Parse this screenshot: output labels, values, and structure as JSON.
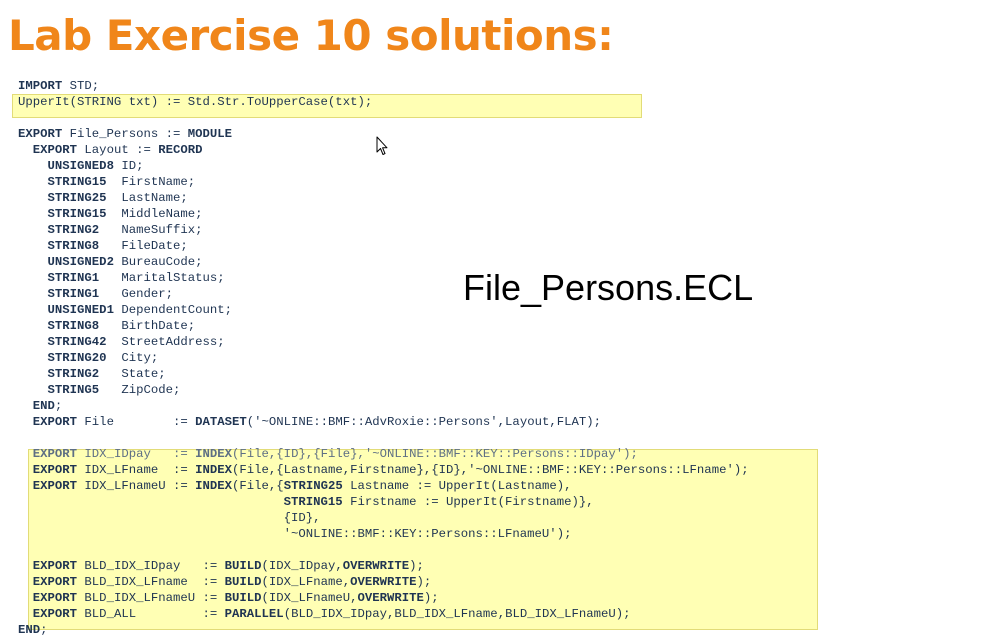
{
  "title": "Lab Exercise 10 solutions:",
  "file_label": "File_Persons.ECL",
  "code_lines": [
    "IMPORT STD;",
    "UpperIt(STRING txt) := Std.Str.ToUpperCase(txt);",
    "",
    "EXPORT File_Persons := MODULE",
    "  EXPORT Layout := RECORD",
    "    UNSIGNED8 ID;",
    "    STRING15  FirstName;",
    "    STRING25  LastName;",
    "    STRING15  MiddleName;",
    "    STRING2   NameSuffix;",
    "    STRING8   FileDate;",
    "    UNSIGNED2 BureauCode;",
    "    STRING1   MaritalStatus;",
    "    STRING1   Gender;",
    "    UNSIGNED1 DependentCount;",
    "    STRING8   BirthDate;",
    "    STRING42  StreetAddress;",
    "    STRING20  City;",
    "    STRING2   State;",
    "    STRING5   ZipCode;",
    "  END;",
    "  EXPORT File        := DATASET('~ONLINE::BMF::AdvRoxie::Persons',Layout,FLAT);",
    "",
    "  EXPORT IDX_IDpay   := INDEX(File,{ID},{File},'~ONLINE::BMF::KEY::Persons::IDpay');",
    "  EXPORT IDX_LFname  := INDEX(File,{Lastname,Firstname},{ID},'~ONLINE::BMF::KEY::Persons::LFname');",
    "  EXPORT IDX_LFnameU := INDEX(File,{STRING25 Lastname := UpperIt(Lastname),",
    "                                    STRING15 Firstname := UpperIt(Firstname)},",
    "                                    {ID},",
    "                                    '~ONLINE::BMF::KEY::Persons::LFnameU');",
    "",
    "  EXPORT BLD_IDX_IDpay   := BUILD(IDX_IDpay,OVERWRITE);",
    "  EXPORT BLD_IDX_LFname  := BUILD(IDX_LFname,OVERWRITE);",
    "  EXPORT BLD_IDX_LFnameU := BUILD(IDX_LFnameU,OVERWRITE);",
    "  EXPORT BLD_ALL         := PARALLEL(BLD_IDX_IDpay,BLD_IDX_LFname,BLD_IDX_LFnameU);",
    "END;"
  ],
  "colors": {
    "title": "#f0861a",
    "highlight": "#ffffb4",
    "highlight_border": "#e2dc78",
    "code_text": "#1f3452"
  },
  "icons": {
    "cursor": "mouse-pointer-icon"
  }
}
